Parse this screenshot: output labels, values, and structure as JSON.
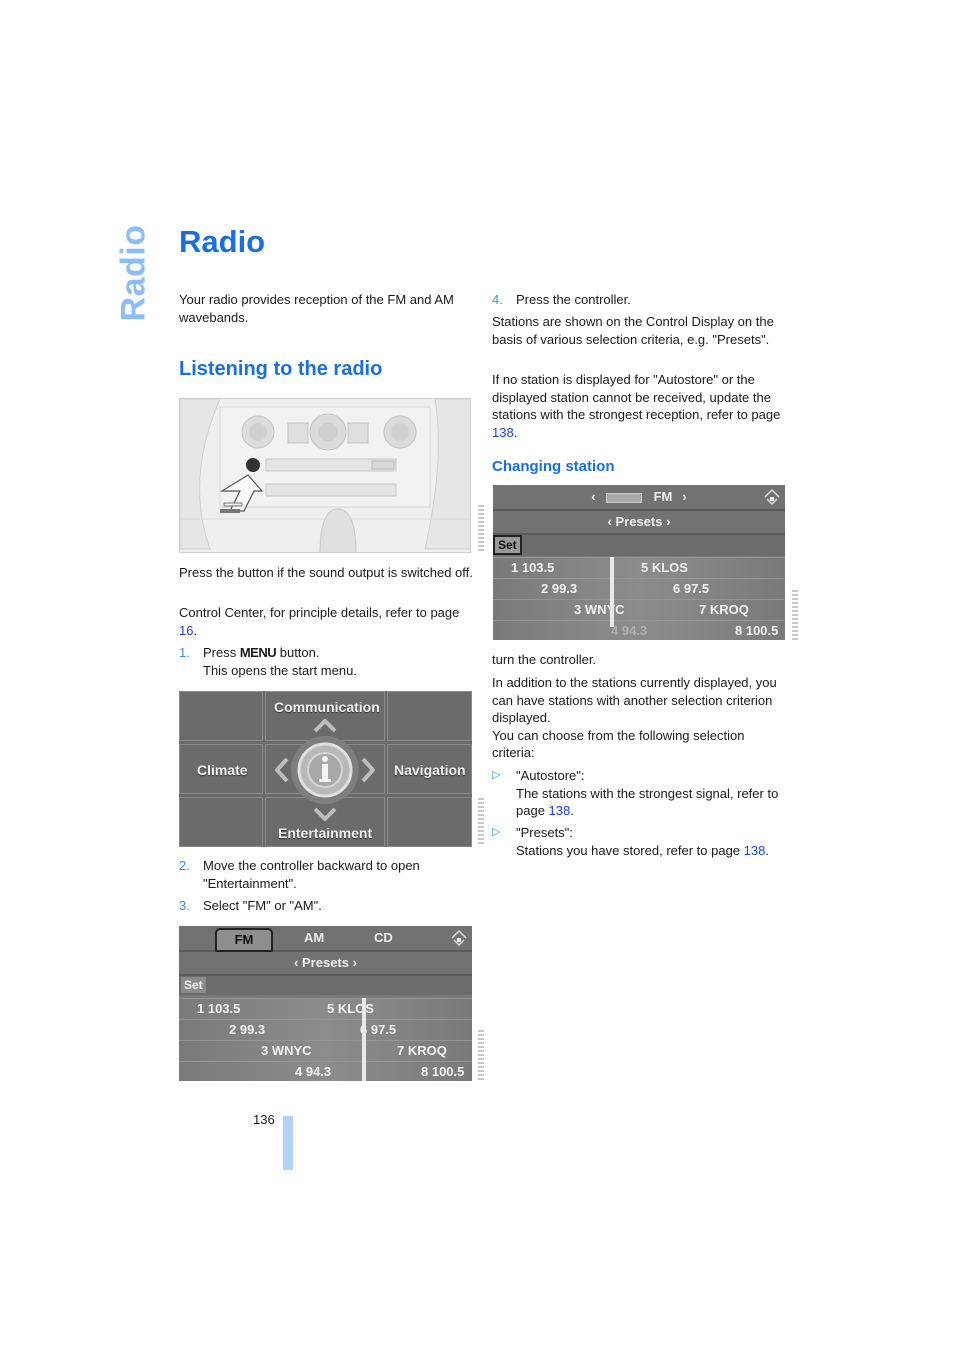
{
  "side_tab": "Radio",
  "title": "Radio",
  "intro": "Your radio provides reception of the FM and AM wavebands.",
  "section_listening": {
    "heading": "Listening to the radio",
    "console_caption": "Press the button if the sound output is switched off.",
    "control_center_text": "Control Center, for principle details, refer to page ",
    "control_center_page": "16",
    "steps": [
      {
        "num": "1.",
        "pre": "Press ",
        "key": "MENU",
        "post": " button.",
        "sub": "This opens the start menu."
      },
      {
        "num": "2.",
        "text": "Move the controller backward to open \"Entertainment\"."
      },
      {
        "num": "3.",
        "text": "Select \"FM\" or \"AM\"."
      },
      {
        "num": "4.",
        "text": "Press the controller."
      }
    ],
    "start_menu": {
      "top": "Communication",
      "left": "Climate",
      "right": "Navigation",
      "bottom": "Entertainment",
      "center_icon": "info-icon"
    },
    "radio_screen_1": {
      "tabs": [
        "FM",
        "AM",
        "CD"
      ],
      "active_tab": "FM",
      "criterion": "Presets",
      "set_label": "Set",
      "stations": [
        {
          "left": "1 103.5",
          "right": "5 KLOS"
        },
        {
          "left": "2 99.3",
          "right": "6 97.5"
        },
        {
          "left": "3 WNYC",
          "right": "7 KROQ"
        },
        {
          "left": "4 94.3",
          "right": "8 100.5"
        }
      ]
    },
    "stations_text": "Stations are shown on the Control Display on the basis of various selection criteria, e.g. \"Presets\".",
    "autostore_text": "If no station is displayed for \"Autostore\" or the displayed station cannot be received, update the stations with the strongest reception, refer to page ",
    "autostore_page": "138"
  },
  "section_changing": {
    "heading": "Changing station",
    "radio_screen_2": {
      "band": "FM",
      "criterion": "Presets",
      "set_label": "Set",
      "stations": [
        {
          "left": "1 103.5",
          "right": "5 KLOS"
        },
        {
          "left": "2 99.3",
          "right": "6 97.5"
        },
        {
          "left": "3 WNYC",
          "right": "7 KROQ"
        },
        {
          "left": "4 94.3",
          "right": "8 100.5"
        }
      ]
    },
    "turn_text": "turn the controller.",
    "addition_text": "In addition to the stations currently displayed, you can have stations with another selection criterion displayed.",
    "choose_text": "You can choose from the following selection criteria:",
    "criteria": [
      {
        "name": "\"Autostore\":",
        "desc": "The stations with the strongest signal, refer to page ",
        "page": "138"
      },
      {
        "name": "\"Presets\":",
        "desc": "Stations you have stored, refer to page ",
        "page": "138"
      }
    ]
  },
  "page_number": "136",
  "colors": {
    "heading_blue": "#1a6fe0",
    "side_tab_blue": "#8cbdf5",
    "link_blue": "#1a3ee0",
    "page_bar": "#b3d3fb"
  }
}
